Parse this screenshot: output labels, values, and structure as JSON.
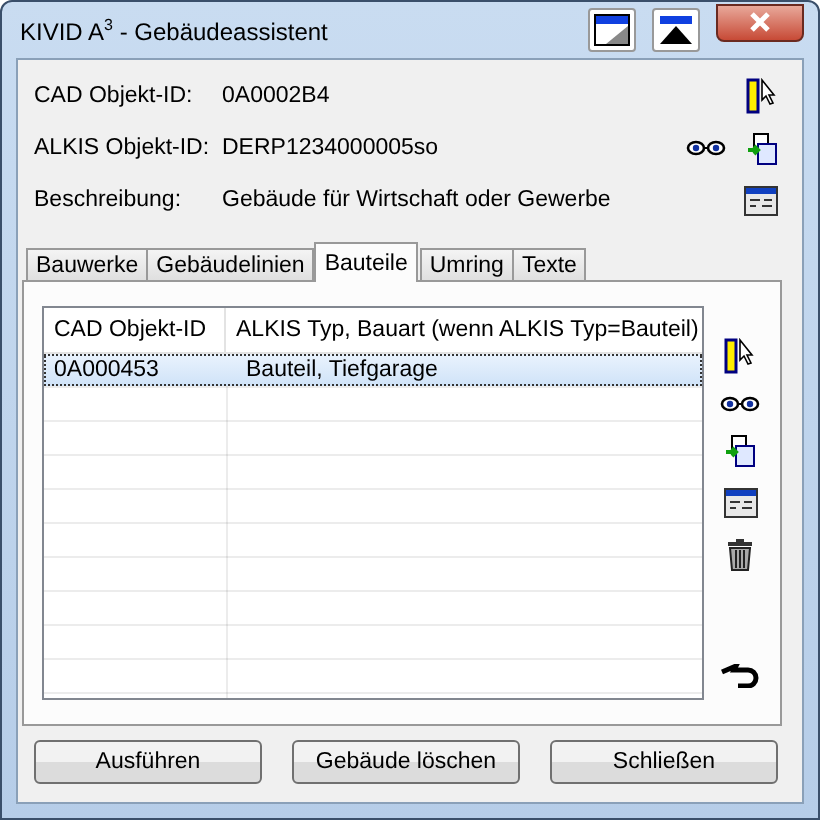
{
  "window": {
    "title": "KIVID A$^{3}$ - Gebäudeassistent"
  },
  "fields": [
    {
      "label": "CAD Objekt-ID:",
      "value": "0A0002B4"
    },
    {
      "label": "ALKIS Objekt-ID:",
      "value": "DERP1234000005so"
    },
    {
      "label": "Beschreibung:",
      "value": "Gebäude für Wirtschaft oder Gewerbe"
    }
  ],
  "tabs": [
    {
      "label": "Bauwerke",
      "selected": false
    },
    {
      "label": "Gebäudelinien",
      "selected": false
    },
    {
      "label": "Bauteile",
      "selected": true
    },
    {
      "label": "Umring",
      "selected": false
    },
    {
      "label": "Texte",
      "selected": false
    }
  ],
  "table": {
    "columns": [
      "CAD Objekt-ID",
      "ALKIS Typ, Bauart (wenn ALKIS Typ=Bauteil)"
    ],
    "rows": [
      {
        "cells": [
          "0A000453",
          "Bauteil, Tiefgarage"
        ],
        "selected": true
      }
    ]
  },
  "buttons": [
    "Ausführen",
    "Gebäude löschen",
    "Schließen"
  ]
}
